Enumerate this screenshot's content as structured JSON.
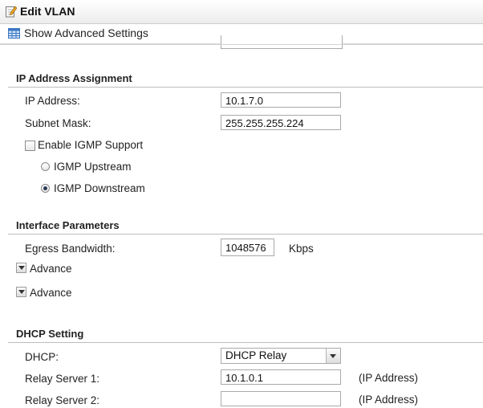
{
  "window": {
    "title": "Edit VLAN"
  },
  "toolbar": {
    "show_advanced_label": "Show Advanced Settings"
  },
  "ip_assignment": {
    "section_title": "IP Address Assignment",
    "ip_address_label": "IP Address:",
    "ip_address_value": "10.1.7.0",
    "subnet_mask_label": "Subnet Mask:",
    "subnet_mask_value": "255.255.255.224",
    "enable_igmp_label": "Enable IGMP Support",
    "enable_igmp_checked": false,
    "igmp_upstream_label": "IGMP Upstream",
    "igmp_upstream_selected": false,
    "igmp_downstream_label": "IGMP Downstream",
    "igmp_downstream_selected": true
  },
  "interface_parameters": {
    "section_title": "Interface Parameters",
    "egress_bandwidth_label": "Egress Bandwidth:",
    "egress_bandwidth_value": "1048576",
    "egress_bandwidth_unit": "Kbps",
    "advance_1_label": "Advance",
    "advance_2_label": "Advance"
  },
  "dhcp_setting": {
    "section_title": "DHCP Setting",
    "dhcp_label": "DHCP:",
    "dhcp_selected": "DHCP Relay",
    "relay_server_1_label": "Relay Server 1:",
    "relay_server_1_value": "10.1.0.1",
    "relay_server_1_hint": "(IP Address)",
    "relay_server_2_label": "Relay Server 2:",
    "relay_server_2_value": "",
    "relay_server_2_hint": "(IP Address)"
  },
  "icons": {
    "title": "edit-pencil-icon",
    "toolbar": "table-grid-icon",
    "advance": "triangle-down-icon",
    "select": "chevron-down-icon"
  },
  "colors": {
    "section_rule": "#bdbdbd",
    "toolbar_icon": "#3a77c4"
  }
}
